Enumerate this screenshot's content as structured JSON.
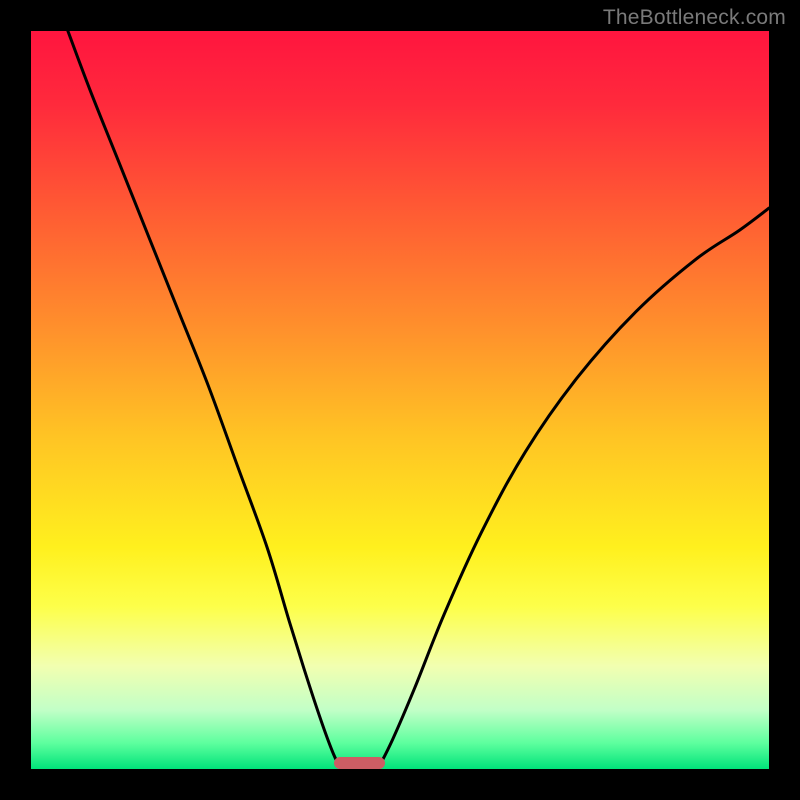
{
  "watermark": "TheBottleneck.com",
  "colors": {
    "frame_bg": "#000000",
    "gradient_stops": [
      {
        "offset": 0.0,
        "color": "#ff153f"
      },
      {
        "offset": 0.1,
        "color": "#ff2a3c"
      },
      {
        "offset": 0.25,
        "color": "#ff5d33"
      },
      {
        "offset": 0.4,
        "color": "#ff8f2c"
      },
      {
        "offset": 0.55,
        "color": "#ffc424"
      },
      {
        "offset": 0.7,
        "color": "#fff01e"
      },
      {
        "offset": 0.78,
        "color": "#fdff4a"
      },
      {
        "offset": 0.86,
        "color": "#f2ffb0"
      },
      {
        "offset": 0.92,
        "color": "#c2ffc7"
      },
      {
        "offset": 0.965,
        "color": "#5dff9e"
      },
      {
        "offset": 1.0,
        "color": "#00e37a"
      }
    ],
    "curve_stroke": "#000000",
    "marker_fill": "#cd5d64"
  },
  "chart_data": {
    "type": "line",
    "title": "",
    "xlabel": "",
    "ylabel": "",
    "xlim": [
      0,
      100
    ],
    "ylim": [
      0,
      100
    ],
    "series": [
      {
        "name": "left-curve",
        "x": [
          5,
          8,
          12,
          16,
          20,
          24,
          28,
          32,
          35,
          37.5,
          39.5,
          41,
          42
        ],
        "y": [
          100,
          92,
          82,
          72,
          62,
          52,
          41,
          30,
          20,
          12,
          6,
          2,
          0
        ]
      },
      {
        "name": "right-curve",
        "x": [
          47,
          49,
          52,
          56,
          61,
          67,
          74,
          82,
          90,
          96,
          100
        ],
        "y": [
          0,
          4,
          11,
          21,
          32,
          43,
          53,
          62,
          69,
          73,
          76
        ]
      }
    ],
    "marker": {
      "x_start": 41,
      "x_end": 48,
      "y": 0,
      "height_pct": 1.6
    }
  }
}
